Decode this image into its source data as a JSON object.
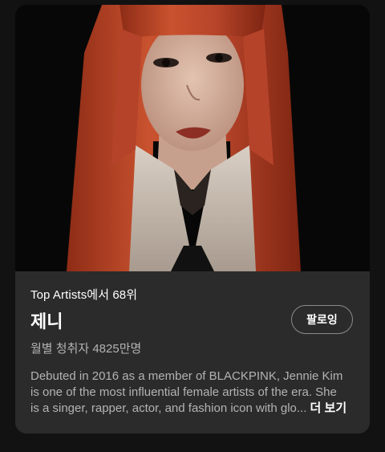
{
  "artist": {
    "rank_text": "Top Artists에서 68위",
    "name": "제니",
    "monthly_listeners": "월별 청취자 4825만명",
    "follow_label": "팔로잉",
    "bio_lines": [
      "Debuted in 2016 as a member of BLACKPINK, Jennie Kim",
      "is one of the most influential female artists of the era. She",
      "is a singer, rapper, actor, and fashion icon with glo..."
    ],
    "more_label": "더 보기"
  },
  "colors": {
    "page_background": "#121212",
    "card_background": "#2b2b2b",
    "primary_text": "#ffffff",
    "secondary_text": "#b3b3b3",
    "hair": "#c24a2a"
  }
}
